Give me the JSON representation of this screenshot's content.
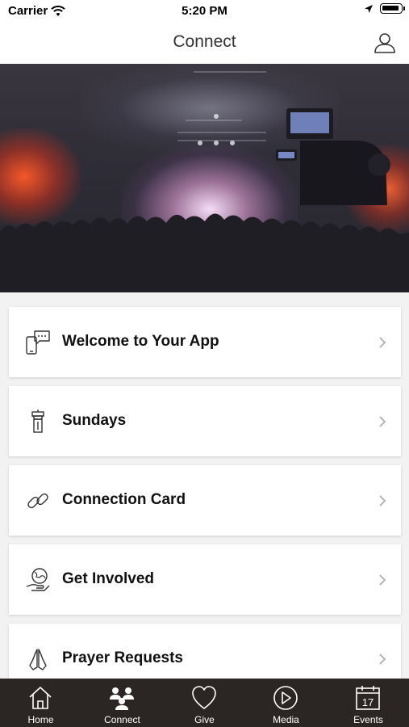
{
  "status_bar": {
    "carrier": "Carrier",
    "time": "5:20 PM"
  },
  "header": {
    "title": "Connect"
  },
  "menu": [
    {
      "label": "Welcome to Your App",
      "icon": "phone-chat-icon"
    },
    {
      "label": "Sundays",
      "icon": "pulpit-icon"
    },
    {
      "label": "Connection Card",
      "icon": "link-icon"
    },
    {
      "label": "Get Involved",
      "icon": "globe-hand-icon"
    },
    {
      "label": "Prayer Requests",
      "icon": "praying-hands-icon"
    }
  ],
  "tabs": [
    {
      "label": "Home",
      "icon": "home-icon"
    },
    {
      "label": "Connect",
      "icon": "people-icon",
      "active": true
    },
    {
      "label": "Give",
      "icon": "heart-icon"
    },
    {
      "label": "Media",
      "icon": "play-icon"
    },
    {
      "label": "Events",
      "icon": "calendar-icon",
      "day": "17"
    }
  ],
  "colors": {
    "tab_bar": "#2b2523",
    "background": "#f2f2f2"
  }
}
